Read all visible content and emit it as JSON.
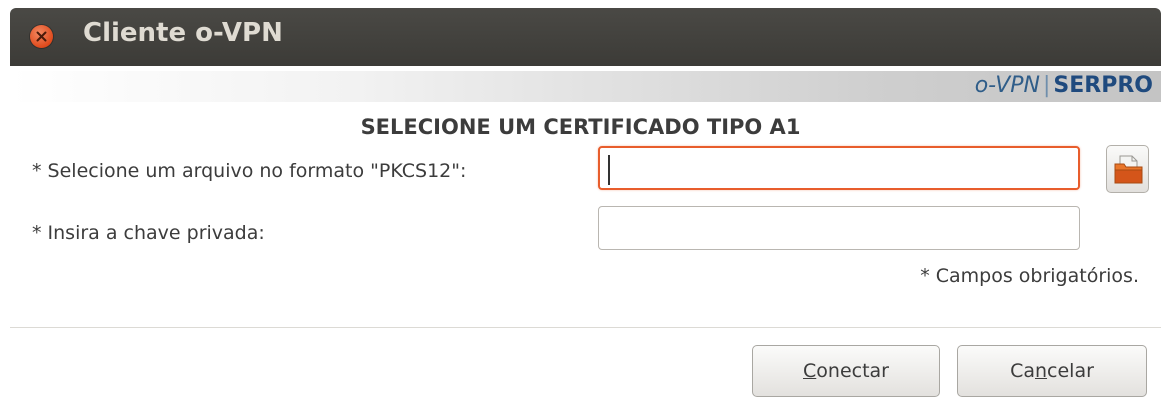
{
  "window": {
    "title": "Cliente o-VPN",
    "close_icon": "close-icon"
  },
  "banner": {
    "brand_ovpn": "o-VPN",
    "brand_separator": "|",
    "brand_serpro": "SERPRO"
  },
  "form": {
    "heading": "SELECIONE UM CERTIFICADO TIPO A1",
    "file_label": "* Selecione um arquivo no formato  \"PKCS12\":",
    "file_value": "",
    "key_label": "* Insira a chave privada:",
    "key_value": "",
    "browse_icon": "folder-icon",
    "required_note": "* Campos obrigatórios."
  },
  "buttons": {
    "connect_mnemonic": "C",
    "connect_rest": "onectar",
    "cancel_first": "Ca",
    "cancel_mnemonic": "n",
    "cancel_rest": "celar"
  },
  "colors": {
    "titlebar": "#3c3b37",
    "focus_border": "#e85d2c",
    "brand_blue": "#1f4a7e"
  }
}
